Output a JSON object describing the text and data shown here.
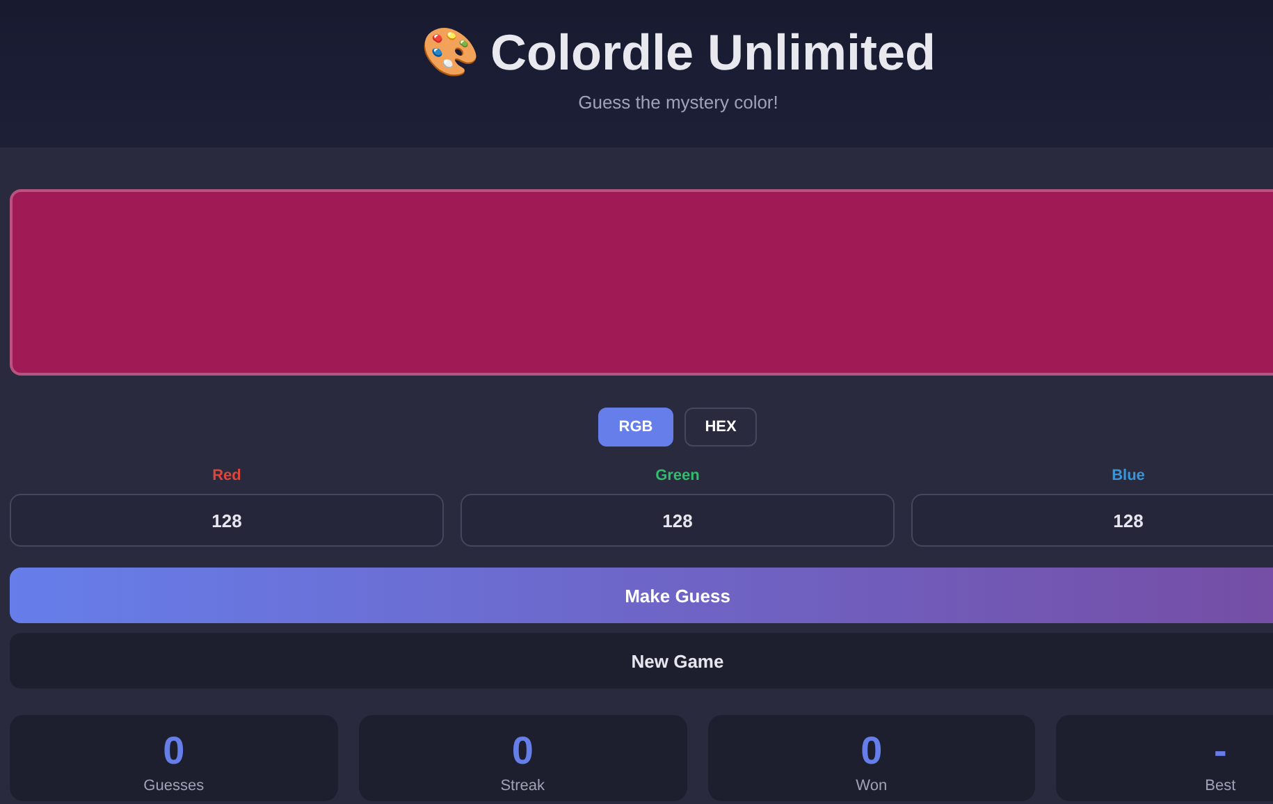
{
  "header": {
    "icon": "🎨",
    "title": "Colordle Unlimited",
    "subtitle": "Guess the mystery color!"
  },
  "mystery_swatch": {
    "color": "#a01b55"
  },
  "mode_tabs": [
    {
      "label": "RGB",
      "selected": true
    },
    {
      "label": "HEX",
      "selected": false
    }
  ],
  "channels": [
    {
      "label": "Red",
      "color": "#e0453a",
      "value": "128"
    },
    {
      "label": "Green",
      "color": "#2fbf6b",
      "value": "128"
    },
    {
      "label": "Blue",
      "color": "#3a95d8",
      "value": "128"
    }
  ],
  "buttons": {
    "guess": "Make Guess",
    "new_game": "New Game"
  },
  "stats": [
    {
      "value": "0",
      "label": "Guesses"
    },
    {
      "value": "0",
      "label": "Streak"
    },
    {
      "value": "0",
      "label": "Won"
    },
    {
      "value": "-",
      "label": "Best"
    }
  ]
}
